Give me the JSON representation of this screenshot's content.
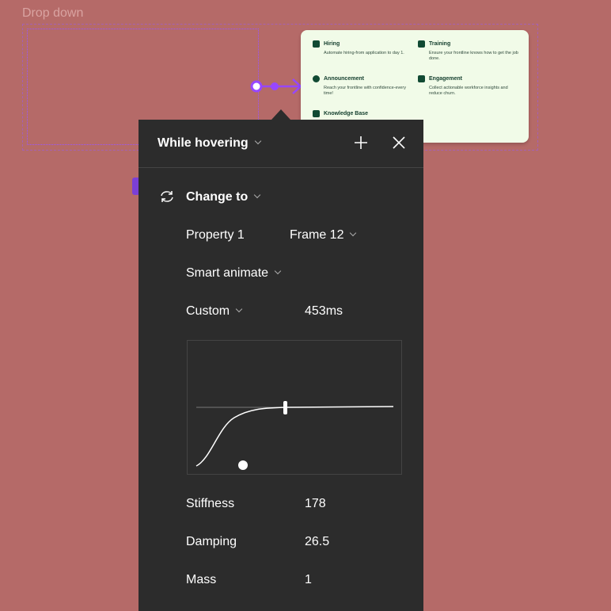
{
  "canvas": {
    "frame_label": "Drop down",
    "accent": "#9747ff"
  },
  "card": {
    "items": [
      {
        "title": "Hiring",
        "desc": "Automate hiring-from application to day 1.",
        "icon": "person-icon"
      },
      {
        "title": "Training",
        "desc": "Ensure your frontline knows how to get the job done.",
        "icon": "chart-icon"
      },
      {
        "title": "Announcement",
        "desc": "Reach your frontline with confidence-every time!",
        "icon": "megaphone-icon"
      },
      {
        "title": "Engagement",
        "desc": "Collect actionable workforce insights and reduce churn.",
        "icon": "list-icon"
      },
      {
        "title": "Knowledge Base",
        "desc": "",
        "icon": "check-icon"
      }
    ]
  },
  "panel": {
    "trigger": "While hovering",
    "action": "Change to",
    "property_label": "Property 1",
    "property_value": "Frame 12",
    "animation": "Smart animate",
    "easing": "Custom",
    "duration": "453ms",
    "params": [
      {
        "label": "Stiffness",
        "value": "178"
      },
      {
        "label": "Damping",
        "value": "26.5"
      },
      {
        "label": "Mass",
        "value": "1"
      }
    ]
  }
}
